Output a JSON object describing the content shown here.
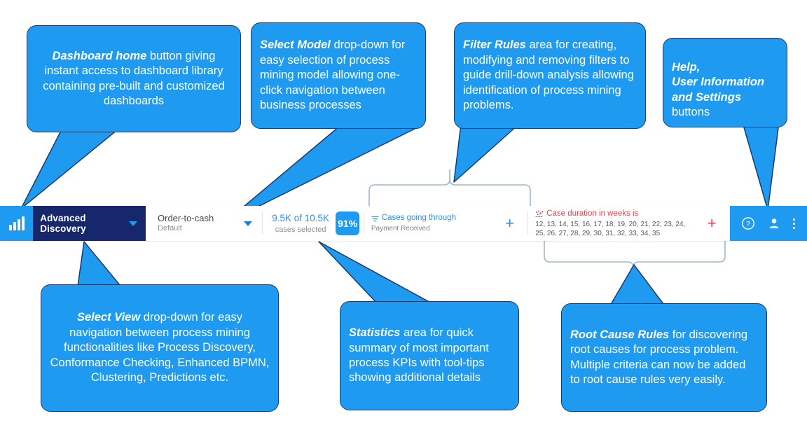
{
  "colors": {
    "callout_fill": "#1e9bf0",
    "callout_border": "#1b3a6b",
    "nav_dark": "#16276b",
    "accent_blue": "#2d8fe8",
    "accent_red": "#e8424c",
    "brace": "#9fb6cf"
  },
  "toolbar": {
    "logo_icon": "bar-chart-logo-icon",
    "view_selector": {
      "label": "Advanced Discovery",
      "caret_icon": "chevron-down-icon"
    },
    "model_selector": {
      "name": "Order-to-cash",
      "sub": "Default",
      "caret_icon": "chevron-down-icon"
    },
    "statistics": {
      "primary": "9.5K of 10.5K",
      "secondary": "cases selected",
      "percent_badge": "91%"
    },
    "filter_rule": {
      "icon": "filter-icon",
      "title": "Cases going through",
      "value": "Payment Received"
    },
    "add_filter_label": "+",
    "root_cause_rule": {
      "icon": "scatter-root-cause-icon",
      "title": "Case duration in weeks is",
      "value": "12, 13, 14, 15, 16, 17, 18, 19, 20, 21, 22, 23, 24, 25, 26, 27, 28, 29, 30, 31, 32, 33, 34, 35"
    },
    "add_root_cause_label": "+",
    "actions": {
      "help_icon": "help-circle-icon",
      "user_icon": "user-account-icon",
      "settings_icon": "more-vertical-icon"
    }
  },
  "callouts": {
    "dashboard_home": {
      "bold": "Dashboard home",
      "rest": " button giving instant access to dashboard library containing pre-built and customized dashboards"
    },
    "select_model": {
      "bold": "Select Model",
      "rest": " drop-down for easy selection of process mining model allowing one-click navigation between business processes"
    },
    "filter_rules": {
      "bold": "Filter Rules",
      "rest": " area for creating, modifying and removing filters to guide drill-down analysis allowing identification of process mining problems."
    },
    "help_settings": {
      "bold": "Help,\nUser Information\nand Settings",
      "rest": "\nbuttons"
    },
    "select_view": {
      "bold": "Select View",
      "rest": " drop-down for easy navigation between process mining functionalities like Process Discovery, Conformance Checking, Enhanced BPMN, Clustering, Predictions etc."
    },
    "statistics": {
      "bold": "Statistics",
      "rest": " area for quick summary of most important process KPIs with tool-tips showing additional details"
    },
    "root_cause_rules": {
      "bold": "Root Cause Rules",
      "rest": " for discovering root causes for process problem. Multiple criteria can now be added to root cause rules very easily."
    }
  }
}
